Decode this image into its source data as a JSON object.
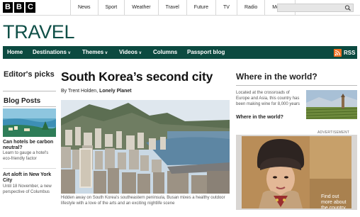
{
  "bbc_logo": [
    "B",
    "B",
    "C"
  ],
  "top_nav": [
    "News",
    "Sport",
    "Weather",
    "Travel",
    "Future",
    "TV",
    "Radio",
    "More..."
  ],
  "search": {
    "placeholder": ""
  },
  "section_title": "TRAVEL",
  "green_nav": {
    "items": [
      {
        "label": "Home"
      },
      {
        "label": "Destinations",
        "chevron": "v"
      },
      {
        "label": "Themes",
        "chevron": "v"
      },
      {
        "label": "Videos",
        "chevron": "v"
      },
      {
        "label": "Columns"
      },
      {
        "label": "Passport blog"
      }
    ],
    "rss_label": "RSS"
  },
  "left": {
    "editors_picks": "Editor's picks",
    "blog_posts_heading": "Blog Posts",
    "posts": [
      {
        "title": "Can hotels be carbon neutral?",
        "desc": "Learn to gauge a hotel's eco-friendly factor"
      },
      {
        "title": "Art aloft in New York City",
        "desc": "Until 18 November, a new perspective of Columbus"
      }
    ]
  },
  "article": {
    "title": "South Korea’s second city",
    "byline_prefix": "By Trent Holden,",
    "byline_source": "Lonely Planet",
    "caption": "Hidden away on South Korea's southeastern peninsula, Busan mixes a healthy outdoor lifestyle with a love of the arts and an exciting nightlife scene"
  },
  "right": {
    "where_title": "Where in the world?",
    "where_desc": "Located at the crossroads of Europe and Asia, this country has been making wine for 8,000 years",
    "where_link": "Where in the world?",
    "advert_label": "ADVERTISEMENT",
    "advert_text": "Find out more about the country"
  },
  "colors": {
    "brand_green": "#0c4a40",
    "title_green": "#0f4f47",
    "rss_orange": "#f26f21"
  }
}
